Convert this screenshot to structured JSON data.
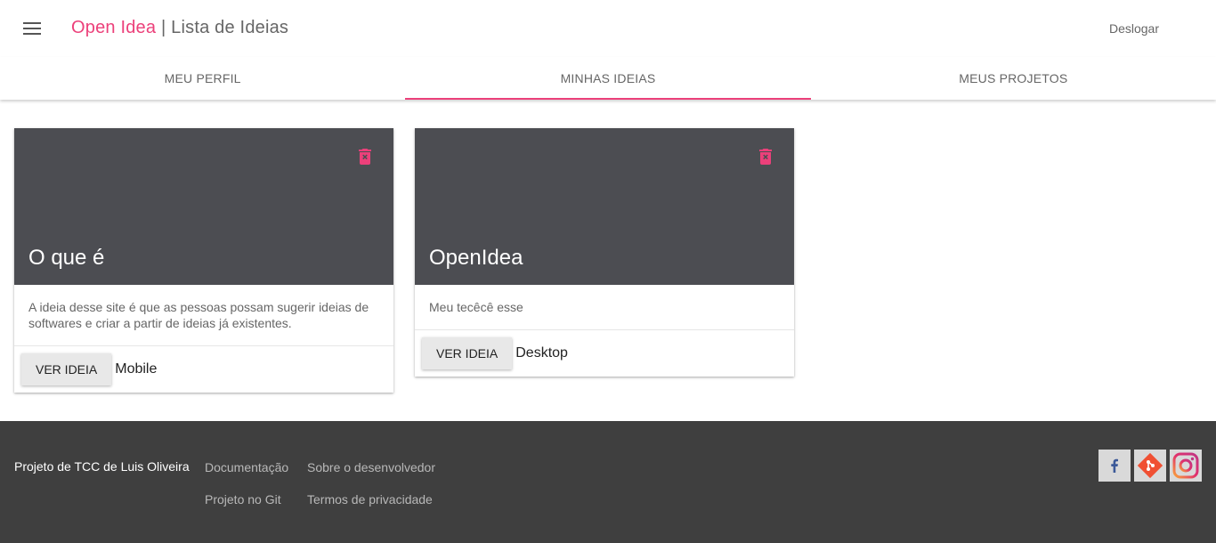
{
  "header": {
    "brand": "Open Idea",
    "separator": "|",
    "page_title": "Lista de Ideias",
    "logout_label": "Deslogar",
    "menu_icon": "menu-icon"
  },
  "tabs": [
    {
      "label": "Meu Perfil",
      "active": false
    },
    {
      "label": "Minhas Ideias",
      "active": true
    },
    {
      "label": "Meus Projetos",
      "active": false
    }
  ],
  "cards": [
    {
      "title": "O que é",
      "description": "A ideia desse site é que as pessoas possam sugerir ideias de softwares e criar a partir de ideias já existentes.",
      "button_label": "Ver Ideia",
      "platform": "Mobile",
      "delete_icon": "delete-icon"
    },
    {
      "title": "OpenIdea",
      "description": "Meu tecêcê esse",
      "button_label": "Ver Ideia",
      "platform": "Desktop",
      "delete_icon": "delete-icon"
    }
  ],
  "footer": {
    "owner": "Projeto de TCC de Luis Oliveira",
    "links": {
      "docs": "Documentação",
      "about": "Sobre o desenvolvedor",
      "git": "Projeto no Git",
      "privacy": "Termos de privacidade"
    },
    "social_icons": [
      "facebook-icon",
      "git-icon",
      "instagram-icon"
    ]
  },
  "colors": {
    "accent": "#ec407a",
    "card_media": "#4c4d52",
    "footer_bg": "#3f3f3f"
  }
}
